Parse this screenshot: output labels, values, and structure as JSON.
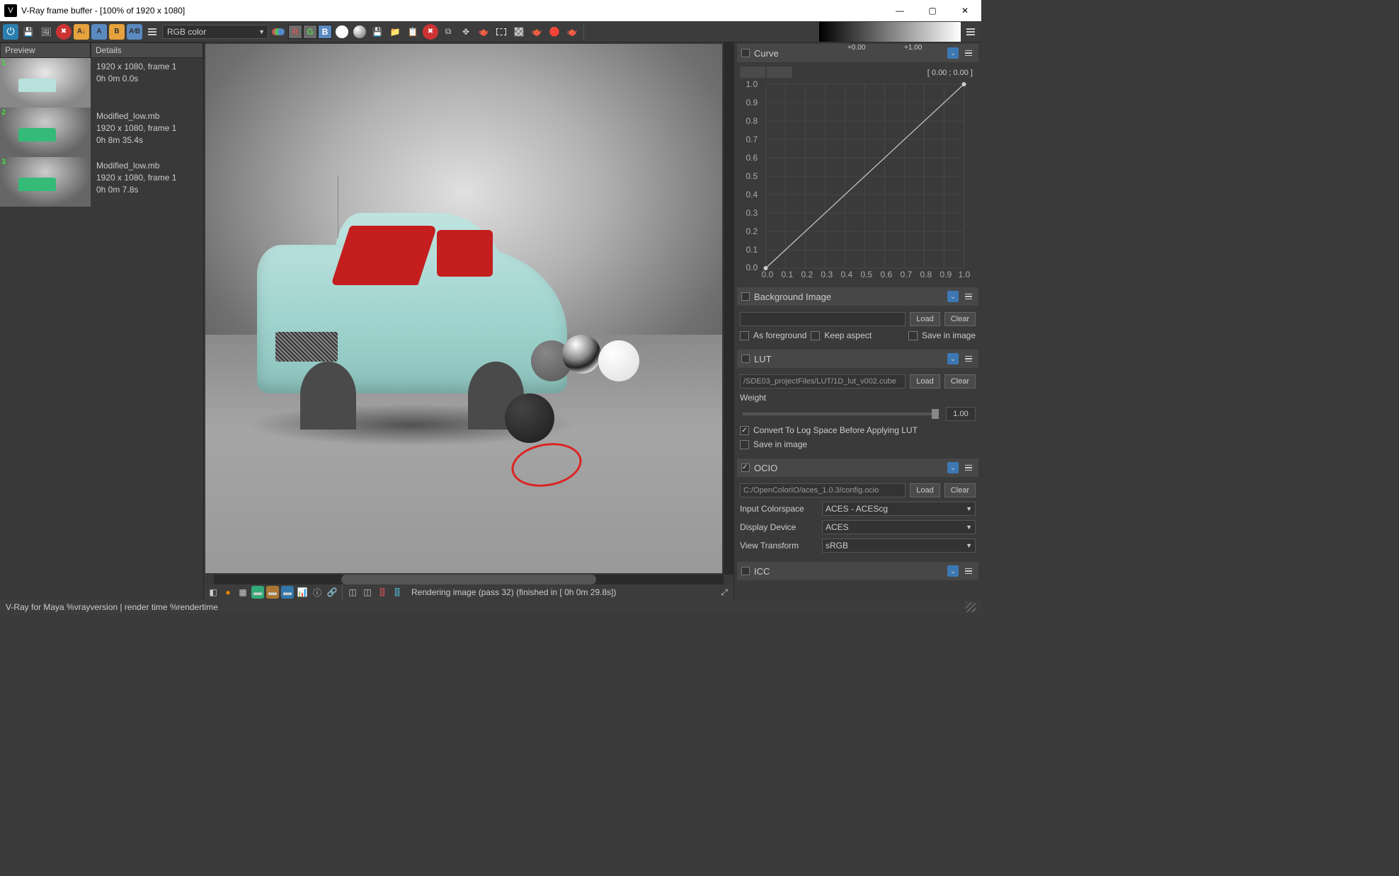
{
  "title": "V-Ray frame buffer - [100% of 1920 x 1080]",
  "channel_combo": "RGB color",
  "rgb": {
    "r": "R",
    "g": "G",
    "b": "B"
  },
  "histogram": {
    "low": "+0.00",
    "high": "+1.00"
  },
  "left": {
    "headers": {
      "preview": "Preview",
      "details": "Details"
    },
    "items": [
      {
        "n": "1",
        "l1": "1920 x 1080, frame 1",
        "l2": "0h 0m 0.0s",
        "l0": ""
      },
      {
        "n": "2",
        "l0": "Modified_low.mb",
        "l1": "1920 x 1080, frame 1",
        "l2": "0h 8m 35.4s"
      },
      {
        "n": "3",
        "l0": "Modified_low.mb",
        "l1": "1920 x 1080, frame 1",
        "l2": "0h 0m 7.8s"
      }
    ]
  },
  "status": "Rendering image (pass 32) (finished in [ 0h  0m 29.8s])",
  "footer": "V-Ray for Maya %vrayversion | render time %rendertime",
  "curve": {
    "title": "Curve",
    "range": "[ 0.00 ; 0.00 ]",
    "yticks": [
      "1.0",
      "0.9",
      "0.8",
      "0.7",
      "0.6",
      "0.5",
      "0.4",
      "0.3",
      "0.2",
      "0.1",
      "0.0"
    ],
    "xticks": [
      "0.0",
      "0.1",
      "0.2",
      "0.3",
      "0.4",
      "0.5",
      "0.6",
      "0.7",
      "0.8",
      "0.9",
      "1.0"
    ]
  },
  "bg": {
    "title": "Background Image",
    "load": "Load",
    "clear": "Clear",
    "as_fg": "As foreground",
    "keep": "Keep aspect",
    "save": "Save in image"
  },
  "lut": {
    "title": "LUT",
    "path": "/SDE03_projectFiles/LUT/1D_lut_v002.cube",
    "load": "Load",
    "clear": "Clear",
    "weight_lbl": "Weight",
    "weight_val": "1.00",
    "convert": "Convert To Log Space Before Applying LUT",
    "save": "Save in image"
  },
  "ocio": {
    "title": "OCIO",
    "path": "C:/OpenColorIO/aces_1.0.3/config.ocio",
    "load": "Load",
    "clear": "Clear",
    "ic_lbl": "Input Colorspace",
    "ic_val": "ACES - ACEScg",
    "dd_lbl": "Display Device",
    "dd_val": "ACES",
    "vt_lbl": "View Transform",
    "vt_val": "sRGB"
  },
  "icc": {
    "title": "ICC"
  },
  "chart_data": {
    "type": "line",
    "title": "Curve",
    "xlabel": "",
    "ylabel": "",
    "xlim": [
      0,
      1
    ],
    "ylim": [
      0,
      1
    ],
    "x": [
      0,
      1
    ],
    "y": [
      0,
      1
    ]
  }
}
